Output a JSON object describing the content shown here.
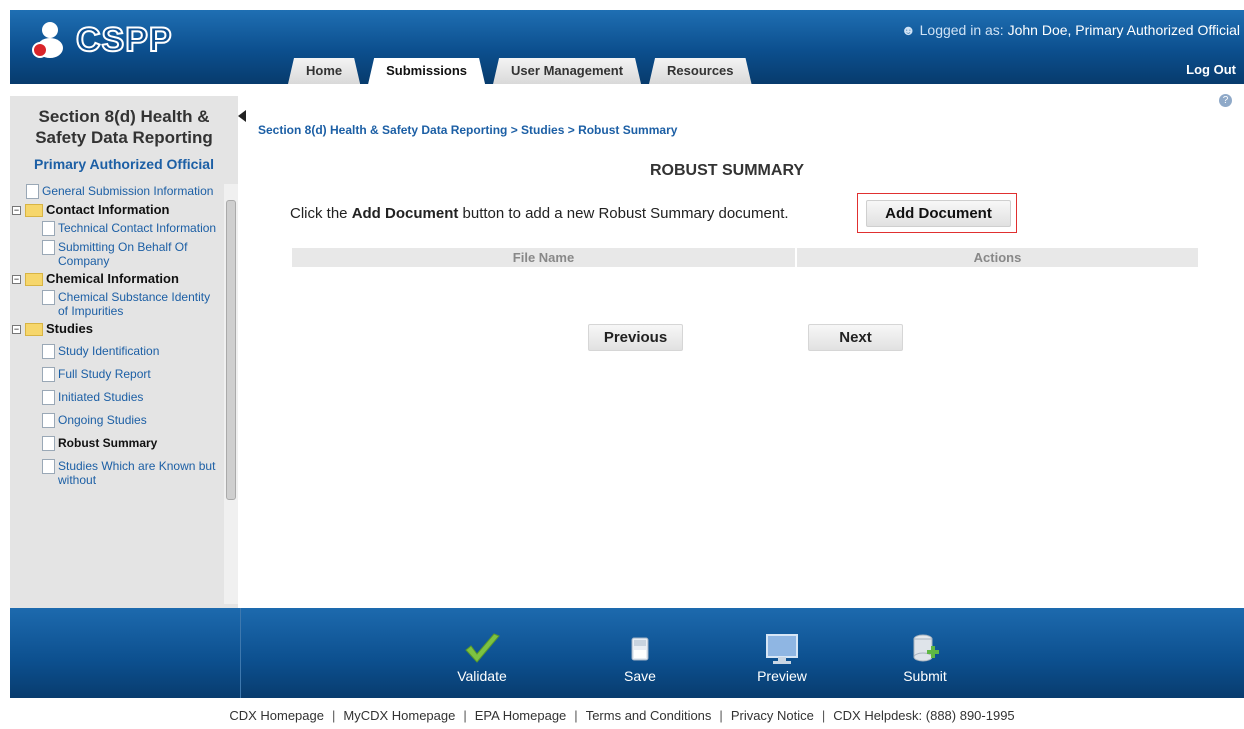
{
  "header": {
    "app_name": "CSPP",
    "logged_in_label": "Logged in as:",
    "logged_in_user": "John Doe, Primary Authorized Official",
    "logout": "Log Out",
    "tabs": [
      {
        "label": "Home"
      },
      {
        "label": "Submissions"
      },
      {
        "label": "User Management"
      },
      {
        "label": "Resources"
      }
    ],
    "active_tab": "Submissions"
  },
  "sidebar": {
    "title_line1": "Section 8(d) Health &",
    "title_line2": "Safety Data Reporting",
    "role": "Primary Authorized Official",
    "tree": {
      "general": "General Submission Information",
      "contact_folder": "Contact Information",
      "technical_contact": "Technical Contact Information",
      "submitting_behalf": "Submitting On Behalf Of Company",
      "chemical_folder": "Chemical Information",
      "chemical_substance": "Chemical Substance Identity of Impurities",
      "studies_folder": "Studies",
      "study_identification": "Study Identification",
      "full_study_report": "Full Study Report",
      "initiated_studies": "Initiated Studies",
      "ongoing_studies": "Ongoing Studies",
      "robust_summary": "Robust Summary",
      "studies_known": "Studies Which are Known but without"
    }
  },
  "main": {
    "breadcrumb": "Section 8(d) Health & Safety Data Reporting > Studies > Robust Summary",
    "title": "ROBUST SUMMARY",
    "instruction_pre": "Click the ",
    "instruction_bold": "Add Document",
    "instruction_post": " button to add a new Robust Summary document.",
    "add_document_button": "Add Document",
    "grid": {
      "columns": [
        "File Name",
        "Actions"
      ]
    },
    "previous_button": "Previous",
    "next_button": "Next"
  },
  "actions": {
    "validate": "Validate",
    "save": "Save",
    "preview": "Preview",
    "submit": "Submit"
  },
  "footer": {
    "links": [
      "CDX Homepage",
      "MyCDX Homepage",
      "EPA Homepage",
      "Terms and Conditions",
      "Privacy Notice",
      "CDX Helpdesk: (888) 890-1995"
    ]
  },
  "colors": {
    "header_blue": "#0c4f8e",
    "link_blue": "#1c5fa5",
    "highlight_red": "#e03030",
    "validate_green": "#7dc242"
  }
}
